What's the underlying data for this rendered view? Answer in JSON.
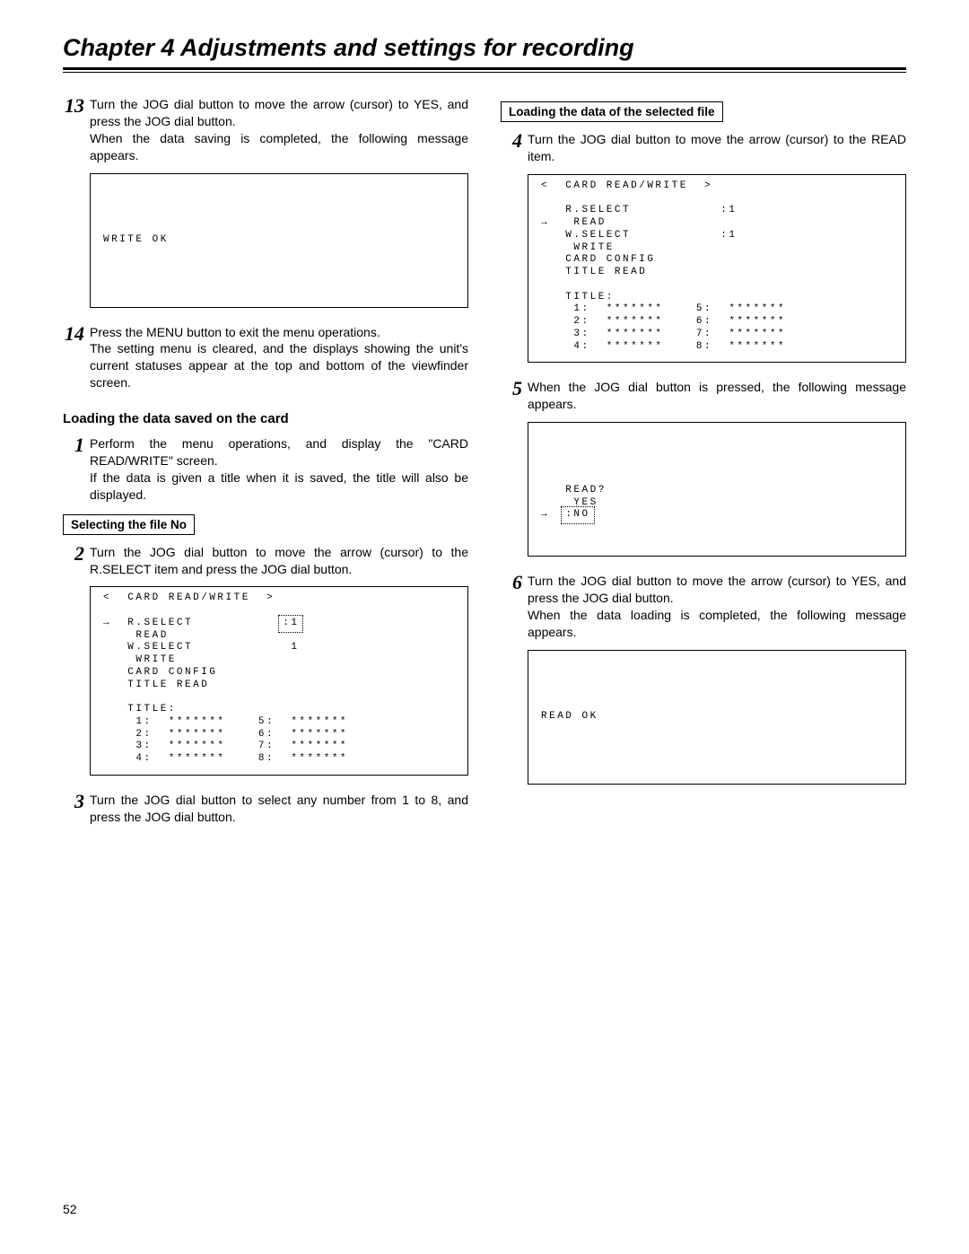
{
  "chapter_title": "Chapter 4  Adjustments and settings for recording",
  "page_number": "52",
  "left": {
    "step13": {
      "num": "13",
      "para1": "Turn the JOG dial button to move the arrow (cursor) to YES, and press the JOG dial button.",
      "para2": "When the data saving is completed, the following message appears.",
      "screen": "WRITE OK"
    },
    "step14": {
      "num": "14",
      "text": "Press the MENU button to exit the menu operations.\nThe setting menu is cleared, and the displays showing the unit's current statuses appear at the top and bottom of the viewfinder screen."
    },
    "heading_load_card": "Loading the data saved on the card",
    "step1": {
      "num": "1",
      "para1": "Perform the menu operations, and display the \"CARD READ/WRITE\" screen.",
      "para2": "If the data is given a title when it is saved, the title will also be displayed."
    },
    "box_selecting": "Selecting the file No",
    "step2": {
      "num": "2",
      "text": "Turn the JOG dial button to move the arrow (cursor) to the R.SELECT item and press the JOG dial button.",
      "screen_header": "<  CARD READ/WRITE  >",
      "screen_lines": [
        "→  R.SELECT           :1:",
        "    READ",
        "   W.SELECT            1",
        "    WRITE",
        "   CARD CONFIG",
        "   TITLE READ",
        "",
        "   TITLE:",
        "    1:  *******    5:  *******",
        "    2:  *******    6:  *******",
        "    3:  *******    7:  *******",
        "    4:  *******    8:  *******"
      ]
    },
    "step3": {
      "num": "3",
      "text": "Turn the JOG dial button to select any number from 1 to 8, and press the JOG dial button."
    }
  },
  "right": {
    "box_loading": "Loading the data of the selected file",
    "step4": {
      "num": "4",
      "text": "Turn the JOG dial button to move the arrow (cursor) to the READ item.",
      "screen_header": "<  CARD READ/WRITE  >",
      "screen_lines": [
        "   R.SELECT           :1",
        "→   READ",
        "   W.SELECT           :1",
        "    WRITE",
        "   CARD CONFIG",
        "   TITLE READ",
        "",
        "   TITLE:",
        "    1:  *******    5:  *******",
        "    2:  *******    6:  *******",
        "    3:  *******    7:  *******",
        "    4:  *******    8:  *******"
      ]
    },
    "step5": {
      "num": "5",
      "text": "When the JOG dial button is pressed, the following message appears.",
      "screen_lines": [
        "   READ?",
        "    YES",
        "→  :NO:"
      ]
    },
    "step6": {
      "num": "6",
      "para1": "Turn the JOG dial button to move the arrow (cursor) to YES, and press the JOG dial button.",
      "para2": "When the data loading is completed, the following message appears.",
      "screen": "READ OK"
    }
  }
}
